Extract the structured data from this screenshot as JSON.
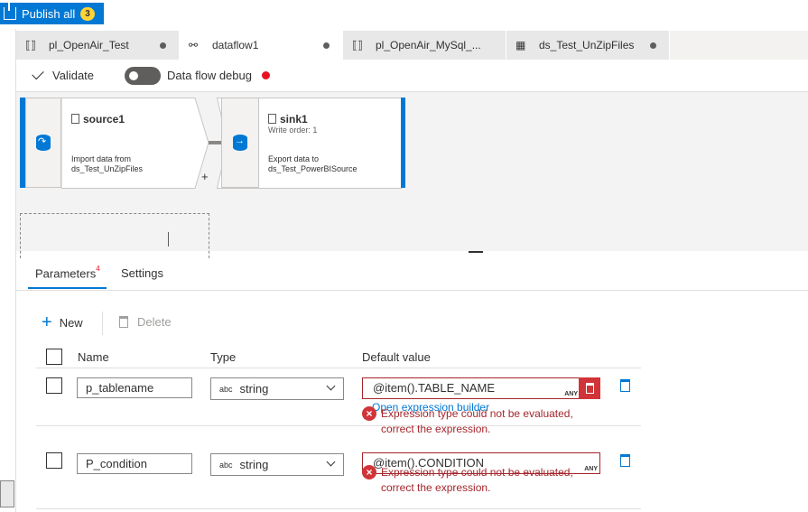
{
  "topbar": {
    "publish_label": "Publish all",
    "publish_count": "3"
  },
  "tabs": [
    {
      "label": "pl_OpenAir_Test",
      "icon": "pipeline-icon"
    },
    {
      "label": "dataflow1",
      "icon": "dataflow-icon"
    },
    {
      "label": "pl_OpenAir_MySql_...",
      "icon": "pipeline-icon"
    },
    {
      "label": "ds_Test_UnZipFiles",
      "icon": "table-icon"
    }
  ],
  "toolbar": {
    "validate_label": "Validate",
    "debug_label": "Data flow debug"
  },
  "canvas": {
    "source": {
      "title": "source1",
      "desc1": "Import data from",
      "desc2": "ds_Test_UnZipFiles"
    },
    "sink": {
      "title": "sink1",
      "write_order": "Write order: 1",
      "desc1": "Export data to",
      "desc2": "ds_Test_PowerBISource"
    },
    "plus": "+"
  },
  "panel": {
    "tab_parameters": "Parameters",
    "tab_parameters_badge": "4",
    "tab_settings": "Settings",
    "new_label": "New",
    "delete_label": "Delete",
    "columns": {
      "name": "Name",
      "type": "Type",
      "default": "Default value"
    },
    "rows": [
      {
        "name": "p_tablename",
        "type": "string",
        "default": "@item().TABLE_NAME",
        "type_badge": "ANY",
        "builder_link": "Open expression builder",
        "error_line1": "Expression type could not be evaluated,",
        "error_line2": "correct the expression."
      },
      {
        "name": "P_condition",
        "type": "string",
        "default": "@item().CONDITION",
        "type_badge": "ANY",
        "error_line1": "Expression type could not be evaluated,",
        "error_line2": "correct the expression."
      }
    ],
    "type_prefix": "abc"
  }
}
